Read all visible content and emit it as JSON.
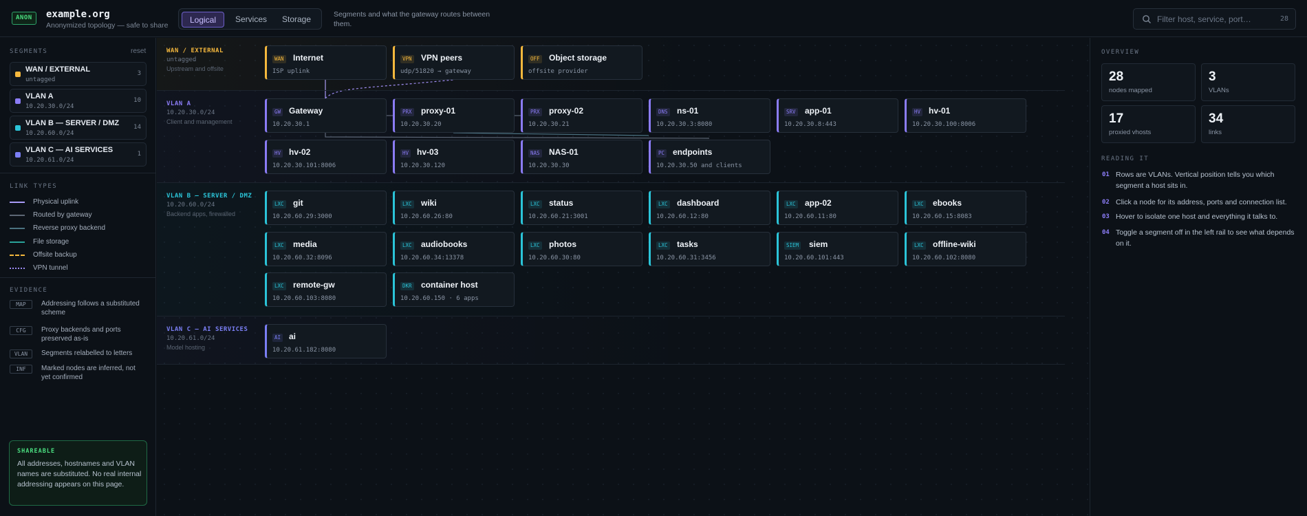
{
  "header": {
    "badge": "ANON",
    "title": "example.org",
    "subtitle": "Anonymized topology — safe to share",
    "tabs": [
      "Logical",
      "Services",
      "Storage"
    ],
    "active_tab": "Logical",
    "description": "Segments and what the gateway routes between them.",
    "search_placeholder": "Filter host, service, port…",
    "search_count": "28"
  },
  "left": {
    "segments_title": "SEGMENTS",
    "reset_label": "reset",
    "segments": [
      {
        "name": "WAN / EXTERNAL",
        "sub": "untagged",
        "count": "3",
        "color": "#f5b83d"
      },
      {
        "name": "VLAN A",
        "sub": "10.20.30.0/24",
        "count": "10",
        "color": "#8b7cf6"
      },
      {
        "name": "VLAN B — SERVER / DMZ",
        "sub": "10.20.60.0/24",
        "count": "14",
        "color": "#2bc4d8"
      },
      {
        "name": "VLAN C — AI SERVICES",
        "sub": "10.20.61.0/24",
        "count": "1",
        "color": "#7b7ff5"
      }
    ],
    "link_types_title": "LINK TYPES",
    "link_types": [
      {
        "label": "Physical uplink",
        "color": "#a99bf7",
        "style": "solid"
      },
      {
        "label": "Routed by gateway",
        "color": "#5d6775",
        "style": "solid"
      },
      {
        "label": "Reverse proxy backend",
        "color": "#4b7280",
        "style": "solid"
      },
      {
        "label": "File storage",
        "color": "#2aa39a",
        "style": "solid"
      },
      {
        "label": "Offsite backup",
        "color": "#f5b83d",
        "style": "dashed"
      },
      {
        "label": "VPN tunnel",
        "color": "#9d8cf5",
        "style": "dotted"
      }
    ],
    "evidence_title": "EVIDENCE",
    "evidence": [
      {
        "tag": "MAP",
        "text": "Addressing follows a substituted scheme"
      },
      {
        "tag": "CFG",
        "text": "Proxy backends and ports preserved as-is"
      },
      {
        "tag": "VLAN",
        "text": "Segments relabelled to letters"
      },
      {
        "tag": "INF",
        "text": "Marked nodes are inferred, not yet confirmed"
      }
    ],
    "share_title": "SHAREABLE",
    "share_text": "All addresses, hostnames and VLAN names are substituted. No real internal addressing appears on this page."
  },
  "bands": [
    {
      "name": "WAN / EXTERNAL",
      "sub": "untagged",
      "desc": "Upstream and offsite",
      "color": "#f5b83d",
      "rows": [
        [
          {
            "tag": "WAN",
            "name": "Internet",
            "addr": "ISP uplink"
          },
          {
            "tag": "VPN",
            "name": "VPN peers",
            "addr": "udp/51820 → gateway"
          },
          {
            "tag": "OFF",
            "name": "Object storage",
            "addr": "offsite provider"
          }
        ]
      ]
    },
    {
      "name": "VLAN A",
      "sub": "10.20.30.0/24",
      "desc": "Client and management",
      "color": "#8b7cf6",
      "rows": [
        [
          {
            "tag": "GW",
            "name": "Gateway",
            "addr": "10.20.30.1"
          },
          {
            "tag": "PRX",
            "name": "proxy-01",
            "addr": "10.20.30.20"
          },
          {
            "tag": "PRX",
            "name": "proxy-02",
            "addr": "10.20.30.21"
          },
          {
            "tag": "DNS",
            "name": "ns-01",
            "addr": "10.20.30.3:8080"
          },
          {
            "tag": "SRV",
            "name": "app-01",
            "addr": "10.20.30.8:443"
          },
          {
            "tag": "HV",
            "name": "hv-01",
            "addr": "10.20.30.100:8006"
          }
        ],
        [
          {
            "tag": "HV",
            "name": "hv-02",
            "addr": "10.20.30.101:8006"
          },
          {
            "tag": "HV",
            "name": "hv-03",
            "addr": "10.20.30.120"
          },
          {
            "tag": "NAS",
            "name": "NAS-01",
            "addr": "10.20.30.30"
          },
          {
            "tag": "PC",
            "name": "endpoints",
            "addr": "10.20.30.50 and clients"
          }
        ]
      ]
    },
    {
      "name": "VLAN B — SERVER / DMZ",
      "sub": "10.20.60.0/24",
      "desc": "Backend apps, firewalled",
      "color": "#2bc4d8",
      "rows": [
        [
          {
            "tag": "LXC",
            "name": "git",
            "addr": "10.20.60.29:3000"
          },
          {
            "tag": "LXC",
            "name": "wiki",
            "addr": "10.20.60.26:80"
          },
          {
            "tag": "LXC",
            "name": "status",
            "addr": "10.20.60.21:3001"
          },
          {
            "tag": "LXC",
            "name": "dashboard",
            "addr": "10.20.60.12:80"
          },
          {
            "tag": "LXC",
            "name": "app-02",
            "addr": "10.20.60.11:80"
          },
          {
            "tag": "LXC",
            "name": "ebooks",
            "addr": "10.20.60.15:8083"
          }
        ],
        [
          {
            "tag": "LXC",
            "name": "media",
            "addr": "10.20.60.32:8096"
          },
          {
            "tag": "LXC",
            "name": "audiobooks",
            "addr": "10.20.60.34:13378"
          },
          {
            "tag": "LXC",
            "name": "photos",
            "addr": "10.20.60.30:80"
          },
          {
            "tag": "LXC",
            "name": "tasks",
            "addr": "10.20.60.31:3456"
          },
          {
            "tag": "SIEM",
            "name": "siem",
            "addr": "10.20.60.101:443"
          },
          {
            "tag": "LXC",
            "name": "offline-wiki",
            "addr": "10.20.60.102:8080"
          }
        ],
        [
          {
            "tag": "LXC",
            "name": "remote-gw",
            "addr": "10.20.60.103:8080"
          },
          {
            "tag": "DKR",
            "name": "container host",
            "addr": "10.20.60.150 · 6 apps"
          }
        ]
      ]
    },
    {
      "name": "VLAN C — AI SERVICES",
      "sub": "10.20.61.0/24",
      "desc": "Model hosting",
      "color": "#7b7ff5",
      "rows": [
        [
          {
            "tag": "AI",
            "name": "ai",
            "addr": "10.20.61.182:8080"
          }
        ]
      ]
    }
  ],
  "right": {
    "overview_title": "OVERVIEW",
    "stats": [
      {
        "value": "28",
        "label": "nodes mapped"
      },
      {
        "value": "3",
        "label": "VLANs"
      },
      {
        "value": "17",
        "label": "proxied vhosts"
      },
      {
        "value": "34",
        "label": "links"
      }
    ],
    "reading_title": "READING IT",
    "reading": [
      {
        "num": "01",
        "text": "Rows are VLANs. Vertical position tells you which segment a host sits in."
      },
      {
        "num": "02",
        "text": "Click a node for its address, ports and connection list."
      },
      {
        "num": "03",
        "text": "Hover to isolate one host and everything it talks to."
      },
      {
        "num": "04",
        "text": "Toggle a segment off in the left rail to see what depends on it."
      }
    ]
  }
}
